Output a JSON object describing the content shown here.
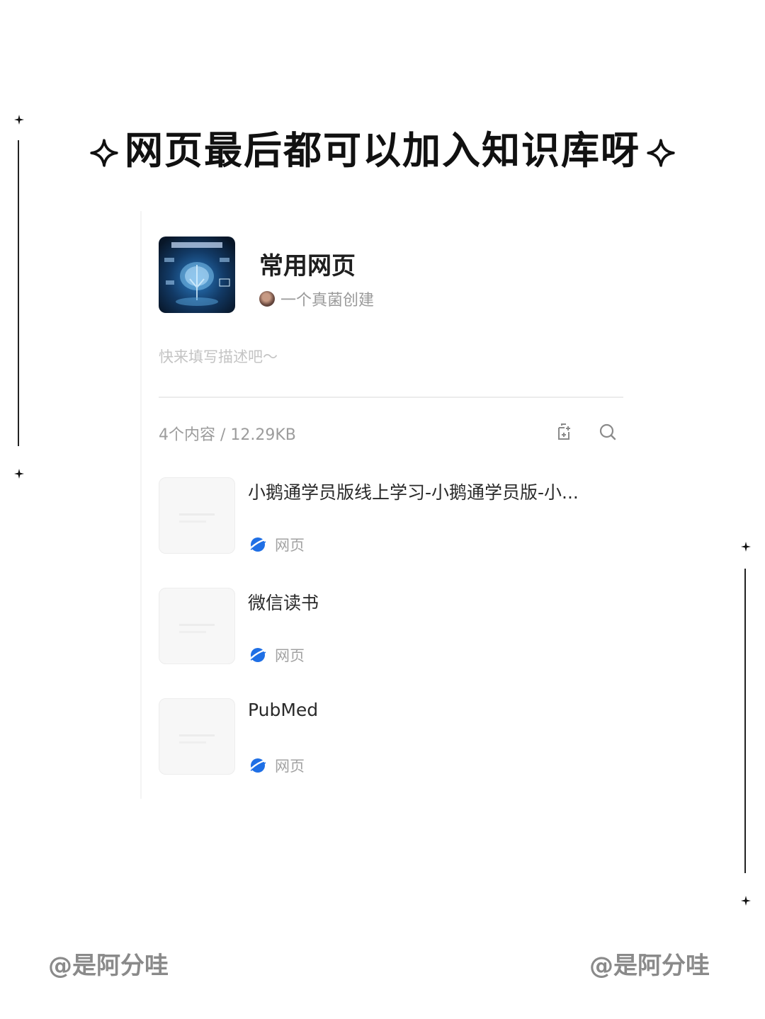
{
  "headline": "网页最后都可以加入知识库呀",
  "knowledge_base": {
    "title": "常用网页",
    "creator": "一个真菌创建",
    "description_placeholder": "快来填写描述吧～",
    "stats": "4个内容 / 12.29KB",
    "cover_icon": "brain-ai-cover-image"
  },
  "toolbar": {
    "add_icon": "add-document-icon",
    "search_icon": "search-icon"
  },
  "items": [
    {
      "title": "小鹅通学员版线上学习-小鹅通学员版-小...",
      "type": "网页",
      "type_icon": "web-page-icon"
    },
    {
      "title": "微信读书",
      "type": "网页",
      "type_icon": "web-page-icon"
    },
    {
      "title": "PubMed",
      "type": "网页",
      "type_icon": "web-page-icon"
    }
  ],
  "watermarks": {
    "left": "@是阿分哇",
    "right": "@是阿分哇"
  },
  "colors": {
    "accent_blue": "#1f6fe5",
    "text_muted": "#9c9c9c"
  }
}
